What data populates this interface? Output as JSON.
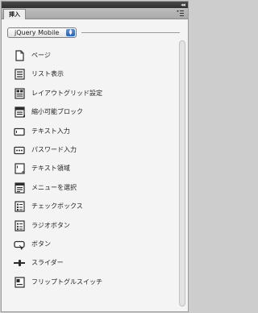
{
  "panel": {
    "tab_label": "挿入",
    "title_icon": "collapse-double-arrow-icon",
    "menu_icon": "panel-menu-icon"
  },
  "category_select": {
    "value": "jQuery Mobile"
  },
  "items": [
    {
      "label": "ページ",
      "icon": "page-icon"
    },
    {
      "label": "リスト表示",
      "icon": "list-view-icon"
    },
    {
      "label": "レイアウトグリッド設定",
      "icon": "layout-grid-icon"
    },
    {
      "label": "縮小可能ブロック",
      "icon": "collapsible-block-icon"
    },
    {
      "label": "テキスト入力",
      "icon": "text-input-icon"
    },
    {
      "label": "パスワード入力",
      "icon": "password-input-icon"
    },
    {
      "label": "テキスト領域",
      "icon": "text-area-icon"
    },
    {
      "label": "メニューを選択",
      "icon": "select-menu-icon"
    },
    {
      "label": "チェックボックス",
      "icon": "checkbox-icon"
    },
    {
      "label": "ラジオボタン",
      "icon": "radio-button-icon"
    },
    {
      "label": "ボタン",
      "icon": "button-icon"
    },
    {
      "label": "スライダー",
      "icon": "slider-icon"
    },
    {
      "label": "フリップトグルスイッチ",
      "icon": "flip-toggle-switch-icon"
    }
  ],
  "colors": {
    "panel_bg": "#f4f4f4",
    "titlebar": "#333333",
    "accent_blue": "#3a72c4",
    "icon_stroke": "#2c2c2c"
  }
}
